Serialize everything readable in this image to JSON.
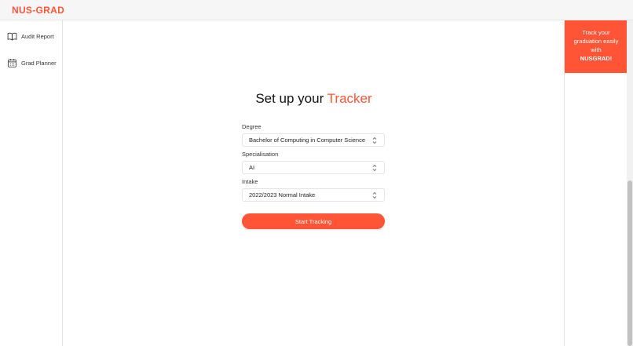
{
  "header": {
    "brand": "NUS-GRAD"
  },
  "sidebar": {
    "items": [
      {
        "label": "Audit Report",
        "icon": "book-icon"
      },
      {
        "label": "Grad Planner",
        "icon": "calendar-icon"
      }
    ]
  },
  "promo": {
    "line1": "Track your",
    "line2": "graduation easily",
    "line3": "with",
    "line4": "NUSGRAD!"
  },
  "form": {
    "title_prefix": "Set up your ",
    "title_accent": "Tracker",
    "degree": {
      "label": "Degree",
      "value": "Bachelor of Computing in Computer Science"
    },
    "specialisation": {
      "label": "Specialisation",
      "value": "AI"
    },
    "intake": {
      "label": "Intake",
      "value": "2022/2023 Normal Intake"
    },
    "submit_label": "Start Tracking"
  },
  "colors": {
    "accent": "#ff5436"
  }
}
